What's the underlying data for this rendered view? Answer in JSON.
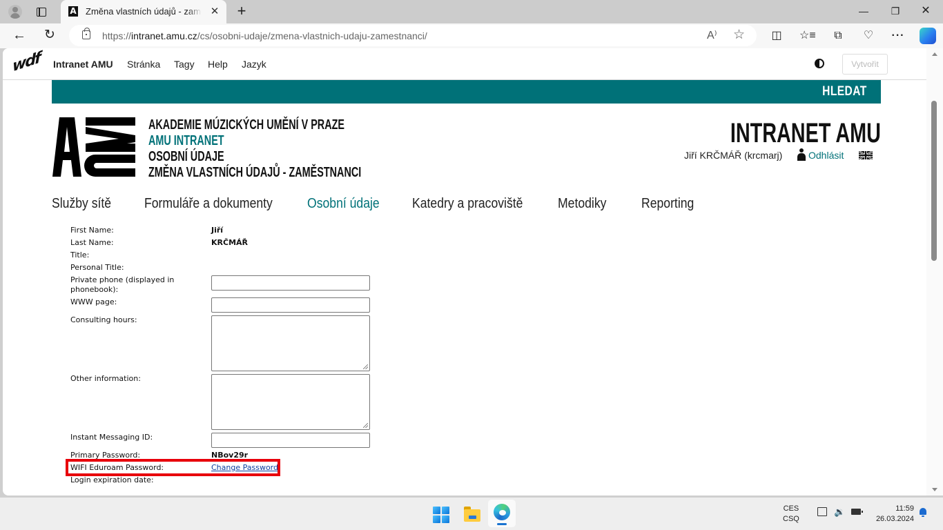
{
  "browser": {
    "tab": {
      "favicon_letter": "A",
      "title": "Změna vlastních údajů - zaměstnanci",
      "close_glyph": "✕"
    },
    "new_tab_glyph": "+",
    "window": {
      "minimize": "—",
      "maximize": "❐",
      "close": "✕"
    },
    "nav": {
      "back_glyph": "←",
      "reload_glyph": "↻"
    },
    "url": {
      "scheme": "https://",
      "host": "intranet.amu.cz",
      "path": "/cs/osobni-udaje/zmena-vlastnich-udaju-zamestnanci/"
    },
    "toolbar_icons": {
      "read_aloud": "A⁾",
      "favorite": "☆",
      "split": "◫",
      "favorites": "☆≡",
      "collections": "⧉",
      "health": "♡",
      "more": "···"
    }
  },
  "admin_bar": {
    "logo": "wdf",
    "site": "Intranet AMU",
    "menu": [
      "Stránka",
      "Tagy",
      "Help",
      "Jazyk"
    ],
    "create_button": "Vytvořit"
  },
  "search": {
    "button": "HLEDAT"
  },
  "header": {
    "breadcrumbs": [
      "AKADEMIE MÚZICKÝCH UMĚNÍ V PRAZE",
      "AMU INTRANET",
      "OSOBNÍ ÚDAJE",
      "ZMĚNA VLASTNÍCH ÚDAJŮ - ZAMĚSTNANCI"
    ],
    "site_title": "INTRANET AMU",
    "user": "Jiří KRČMÁŘ (krcmarj)",
    "logout": "Odhlásit"
  },
  "main_nav": [
    "Služby sítě",
    "Formuláře a dokumenty",
    "Osobní údaje",
    "Katedry a pracoviště",
    "Metodiky",
    "Reporting"
  ],
  "form": {
    "first_name": {
      "label": "First Name:",
      "value": "Jiří"
    },
    "last_name": {
      "label": "Last Name:",
      "value": "KRČMÁŘ"
    },
    "title": {
      "label": "Title:",
      "value": ""
    },
    "personal_title": {
      "label": "Personal Title:",
      "value": ""
    },
    "private_phone": {
      "label": "Private phone (displayed in phonebook):",
      "value": ""
    },
    "www_page": {
      "label": "WWW page:",
      "value": ""
    },
    "consulting_hours": {
      "label": "Consulting hours:",
      "value": ""
    },
    "other_information": {
      "label": "Other information:",
      "value": ""
    },
    "instant_messaging": {
      "label": "Instant Messaging ID:",
      "value": ""
    },
    "primary_password": {
      "label": "Primary Password:",
      "value": "NBov29r"
    },
    "wifi_password": {
      "label": "WIFI Eduroam Password:",
      "link": "Change Password"
    },
    "login_expiration": {
      "label": "Login expiration date:",
      "value": ""
    }
  },
  "highlight_color": "#e8000b",
  "accent_color": "#007178",
  "taskbar": {
    "lang_1": "CES",
    "lang_2": "CSQ",
    "time": "11:59",
    "date": "26.03.2024",
    "volume_glyph": "🔉"
  }
}
